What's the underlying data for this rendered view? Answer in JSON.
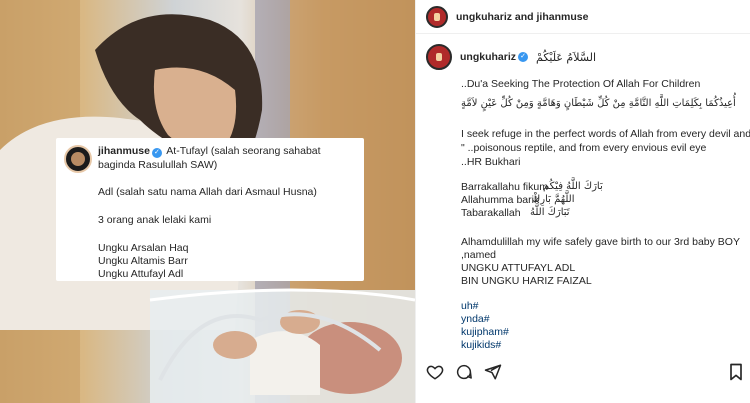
{
  "overlay_comment": {
    "username": "jihanmuse",
    "text": "At-Tufayl (salah seorang sahabat baginda Rasulullah SAW)",
    "lines": [
      "Adl (salah satu nama Allah dari Asmaul Husna)",
      "3 orang anak lelaki kami",
      "Ungku Arsalan Haq",
      "Ungku Altamis Barr",
      "Ungku Attufayl Adl"
    ]
  },
  "post": {
    "header": {
      "accounts": "ungkuhariz and jihanmuse"
    },
    "caption": {
      "username": "ungkuhariz",
      "salaam": "السَّلاَمُ عَلَيْكُمْ",
      "dua_title": "..Du'a Seeking The Protection Of Allah For Children",
      "arabic_dua": "أُعِيذُكُمَا بِكَلِمَاتِ اللَّهِ التَّامَّةِ مِنْ كُلِّ شَيْطَانٍ وَهَامَّةٍ وَمِنْ كُلِّ عَيْنٍ لاَمَّةٍ",
      "english_line1": "I seek refuge in the perfect words of Allah from every devil and\"",
      "english_line2": "\" ..poisonous reptile, and from every envious evil eye",
      "source": "..HR Bukhari",
      "blessings": [
        {
          "latin": "Barrakallahu fikum",
          "arabic": "بَارَكَ اللَّهُ فِيْكُم"
        },
        {
          "latin": "Allahumma barik",
          "arabic": "اللَّهُمَّ بَارِكْ"
        },
        {
          "latin": "Tabarakallah",
          "arabic": "تَبَارَكَ اللَّهُ"
        }
      ],
      "announcement_line1": "Alhamdulillah my wife safely gave birth to our 3rd baby BOY",
      "announcement_line2": ",named",
      "name_line1": "UNGKU ATTUFAYL ADL",
      "name_line2": "BIN UNGKU HARIZ FAIZAL",
      "hashtags": [
        "uh#",
        "ynda#",
        "kujipham#",
        "kujikids#"
      ]
    }
  }
}
